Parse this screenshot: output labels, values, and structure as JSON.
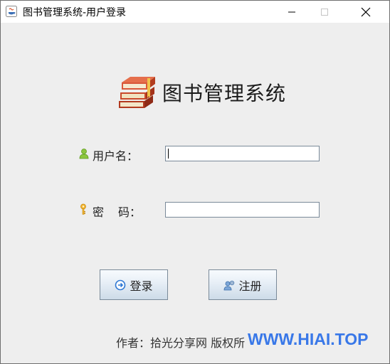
{
  "window": {
    "title": "图书管理系统-用户登录",
    "controls": {
      "minimize": "minimize-icon",
      "maximize": "maximize-icon",
      "close": "close-icon"
    }
  },
  "header": {
    "app_title": "图书管理系统",
    "icon": "books-icon"
  },
  "form": {
    "username": {
      "label": "用户名：",
      "value": "",
      "icon": "user-icon"
    },
    "password": {
      "label_first": "密",
      "label_second": "码：",
      "value": "",
      "icon": "key-icon"
    }
  },
  "buttons": {
    "login": {
      "label": "登录",
      "icon": "login-arrow-icon"
    },
    "register": {
      "label": "注册",
      "icon": "register-user-icon"
    }
  },
  "footer": {
    "text": "作者：拾光分享网 版权所",
    "watermark": "WWW.HIAI.TOP"
  },
  "colors": {
    "background": "#eeeeee",
    "titlebar": "#ffffff",
    "watermark": "#2a6ee8"
  }
}
